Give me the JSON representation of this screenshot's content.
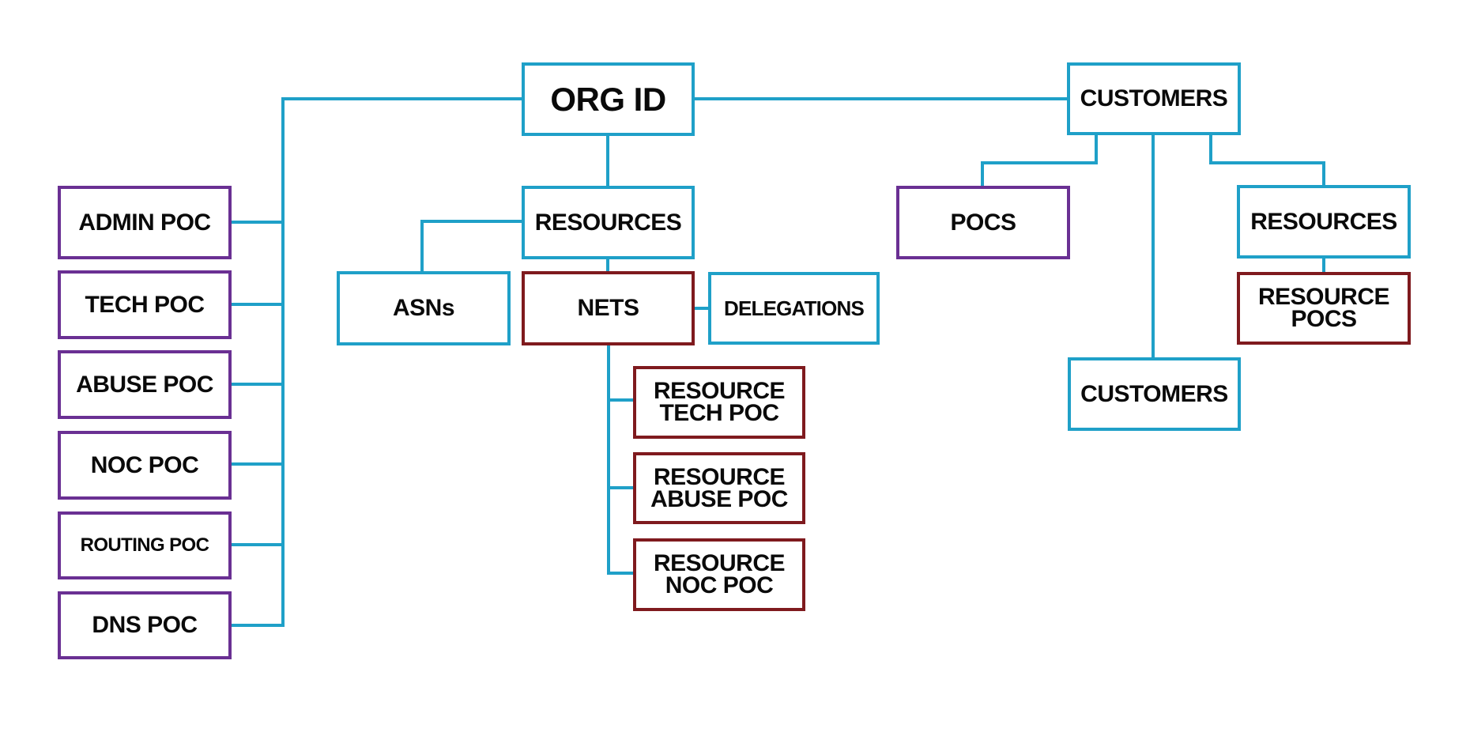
{
  "colors": {
    "connector": "#1fa0c8",
    "org_node": "#1fa0c8",
    "poc_node": "#6a3093",
    "resource_poc_node": "#7f1a1e"
  },
  "nodes": {
    "org_id": {
      "label": "ORG ID",
      "kind": "org"
    },
    "org_pocs": [
      {
        "label": "ADMIN POC",
        "kind": "poc"
      },
      {
        "label": "TECH POC",
        "kind": "poc"
      },
      {
        "label": "ABUSE POC",
        "kind": "poc"
      },
      {
        "label": "NOC POC",
        "kind": "poc"
      },
      {
        "label": "ROUTING POC",
        "kind": "poc"
      },
      {
        "label": "DNS POC",
        "kind": "poc"
      }
    ],
    "resources": {
      "label": "RESOURCES",
      "kind": "org"
    },
    "asns": {
      "label": "ASNs",
      "kind": "org"
    },
    "nets": {
      "label": "NETS",
      "kind": "resource_poc"
    },
    "delegations": {
      "label": "DELEGATIONS",
      "kind": "org"
    },
    "resource_pocs": [
      {
        "label": "RESOURCE\nTECH POC",
        "kind": "resource_poc"
      },
      {
        "label": "RESOURCE\nABUSE POC",
        "kind": "resource_poc"
      },
      {
        "label": "RESOURCE\nNOC POC",
        "kind": "resource_poc"
      }
    ],
    "customers": {
      "label": "CUSTOMERS",
      "kind": "org"
    },
    "customer_pocs": {
      "label": "POCS",
      "kind": "poc"
    },
    "customer_resources": {
      "label": "RESOURCES",
      "kind": "org"
    },
    "customer_resource_pocs": {
      "label": "RESOURCE\nPOCS",
      "kind": "resource_poc"
    },
    "sub_customers": {
      "label": "CUSTOMERS",
      "kind": "org"
    }
  },
  "edges": [
    [
      "ORG ID",
      "ADMIN POC"
    ],
    [
      "ORG ID",
      "TECH POC"
    ],
    [
      "ORG ID",
      "ABUSE POC"
    ],
    [
      "ORG ID",
      "NOC POC"
    ],
    [
      "ORG ID",
      "ROUTING POC"
    ],
    [
      "ORG ID",
      "DNS POC"
    ],
    [
      "ORG ID",
      "RESOURCES"
    ],
    [
      "ORG ID",
      "CUSTOMERS"
    ],
    [
      "RESOURCES",
      "ASNs"
    ],
    [
      "RESOURCES",
      "NETS"
    ],
    [
      "NETS",
      "DELEGATIONS"
    ],
    [
      "NETS",
      "RESOURCE TECH POC"
    ],
    [
      "NETS",
      "RESOURCE ABUSE POC"
    ],
    [
      "NETS",
      "RESOURCE NOC POC"
    ],
    [
      "CUSTOMERS",
      "POCS"
    ],
    [
      "CUSTOMERS",
      "RESOURCES"
    ],
    [
      "CUSTOMERS",
      "CUSTOMERS"
    ],
    [
      "RESOURCES",
      "RESOURCE POCS"
    ]
  ]
}
